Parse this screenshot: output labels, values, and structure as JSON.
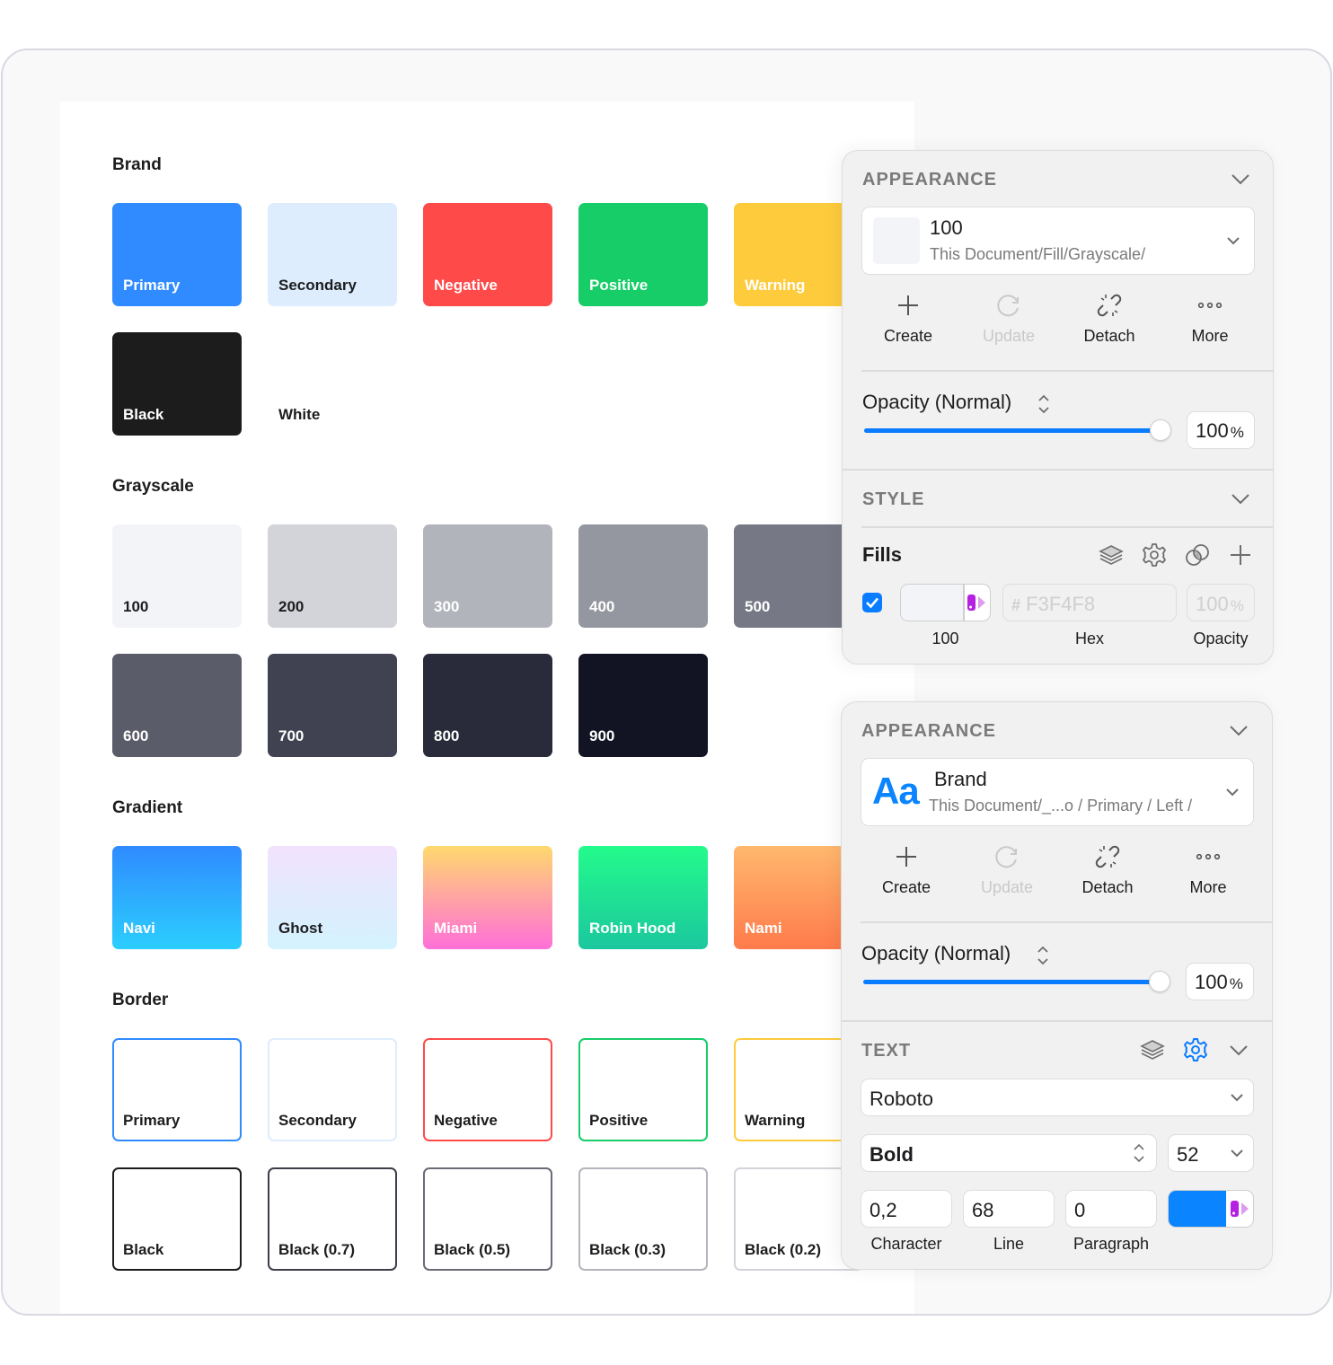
{
  "canvas": {
    "sections": {
      "brand": {
        "title": "Brand"
      },
      "grayscale": {
        "title": "Grayscale"
      },
      "gradient": {
        "title": "Gradient"
      },
      "border": {
        "title": "Border"
      }
    },
    "brand": [
      {
        "label": "Primary",
        "color": "#2f8bff"
      },
      {
        "label": "Secondary",
        "color": "#ddedfd"
      },
      {
        "label": "Negative",
        "color": "#ff4a4a"
      },
      {
        "label": "Positive",
        "color": "#16cd68"
      },
      {
        "label": "Warning",
        "color": "#fecb3d"
      },
      {
        "label": "Black",
        "color": "#1c1c1c"
      },
      {
        "label": "White",
        "color": "#ffffff"
      }
    ],
    "grayscale": [
      {
        "label": "100",
        "color": "#f3f4f8"
      },
      {
        "label": "200",
        "color": "#d3d4d9"
      },
      {
        "label": "300",
        "color": "#b2b4bc"
      },
      {
        "label": "400",
        "color": "#9496a0"
      },
      {
        "label": "500",
        "color": "#767885"
      },
      {
        "label": "600",
        "color": "#5b5c69"
      },
      {
        "label": "700",
        "color": "#404251"
      },
      {
        "label": "800",
        "color": "#292b3a"
      },
      {
        "label": "900",
        "color": "#121424"
      }
    ],
    "gradient": [
      {
        "label": "Navi",
        "from": "#2f8bff",
        "to": "#2ccefe"
      },
      {
        "label": "Ghost",
        "from": "#f1e2fd",
        "to": "#d3f3fe"
      },
      {
        "label": "Miami",
        "from": "#ffd96e",
        "to": "#ff6fd8"
      },
      {
        "label": "Robin Hood",
        "from": "#23fb8b",
        "to": "#1bc79e"
      },
      {
        "label": "Nami",
        "from": "#ffb86e",
        "to": "#ff7b4b"
      }
    ],
    "border": [
      {
        "label": "Primary",
        "color": "#2f8bff"
      },
      {
        "label": "Secondary",
        "color": "#ddedfd"
      },
      {
        "label": "Negative",
        "color": "#ff4a4a"
      },
      {
        "label": "Positive",
        "color": "#16cd68"
      },
      {
        "label": "Warning",
        "color": "#fecb3d"
      },
      {
        "label": "Black",
        "color": "#1c1c1c"
      },
      {
        "label": "Black (0.7)",
        "color": "#3d3e4a"
      },
      {
        "label": "Black (0.5)",
        "color": "#6a6b77"
      },
      {
        "label": "Black (0.3)",
        "color": "#b4b5bc"
      },
      {
        "label": "Black (0.2)",
        "color": "#d3d4d9"
      }
    ]
  },
  "panel1": {
    "appearance_header": "APPEARANCE",
    "style_name": "100",
    "style_path": "This Document/Fill/Grayscale/",
    "style_swatch_color": "#f3f4f8",
    "actions": {
      "create": "Create",
      "update": "Update",
      "detach": "Detach",
      "more": "More"
    },
    "opacity_label": "Opacity (Normal)",
    "opacity_value": "100",
    "opacity_unit": "%",
    "opacity_fraction": 1.0,
    "style_header": "STYLE",
    "fills_label": "Fills",
    "fill": {
      "enabled": true,
      "swatch_color": "#f3f4f8",
      "swatch_caption": "100",
      "hex_prefix": "#",
      "hex_value": "F3F4F8",
      "hex_caption": "Hex",
      "opacity_value": "100",
      "opacity_unit": "%",
      "opacity_caption": "Opacity"
    }
  },
  "panel2": {
    "appearance_header": "APPEARANCE",
    "style_preview": "Aa",
    "style_name": "Brand",
    "style_path": "This Document/_...o / Primary / Left /",
    "actions": {
      "create": "Create",
      "update": "Update",
      "detach": "Detach",
      "more": "More"
    },
    "opacity_label": "Opacity (Normal)",
    "opacity_value": "100",
    "opacity_unit": "%",
    "opacity_fraction": 1.0,
    "text_header": "TEXT",
    "font_family": "Roboto",
    "font_weight": "Bold",
    "font_size": "52",
    "character": "0,2",
    "character_caption": "Character",
    "line": "68",
    "line_caption": "Line",
    "paragraph": "0",
    "paragraph_caption": "Paragraph",
    "text_color": "#0a84ff"
  },
  "colors": {
    "accent": "#0a7cff",
    "icon_purple": "#b620e0",
    "icon_purple_light": "#dd9cf0"
  }
}
